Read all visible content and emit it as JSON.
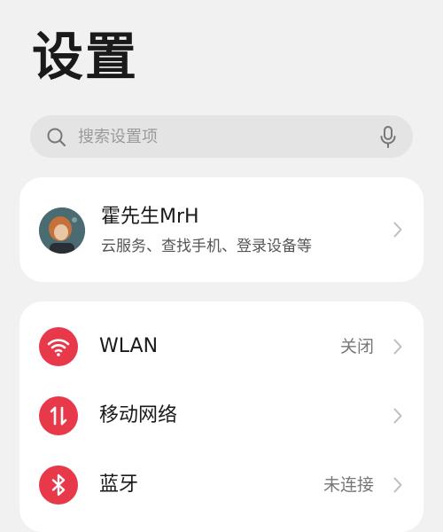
{
  "page": {
    "title": "设置"
  },
  "search": {
    "placeholder": "搜索设置项",
    "search_icon": "search-icon",
    "mic_icon": "microphone-icon"
  },
  "account": {
    "name": "霍先生MrH",
    "subtitle": "云服务、查找手机、登录设备等",
    "avatar_icon": "avatar"
  },
  "settings": {
    "items": [
      {
        "label": "WLAN",
        "value": "关闭",
        "icon": "wifi-icon",
        "color": "#e8394a"
      },
      {
        "label": "移动网络",
        "value": "",
        "icon": "mobile-data-icon",
        "color": "#e8394a"
      },
      {
        "label": "蓝牙",
        "value": "未连接",
        "icon": "bluetooth-icon",
        "color": "#e8394a"
      }
    ]
  },
  "colors": {
    "background": "#f1f1f1",
    "card": "#ffffff",
    "search_bg": "#e4e4e4",
    "accent_red": "#e8394a"
  }
}
